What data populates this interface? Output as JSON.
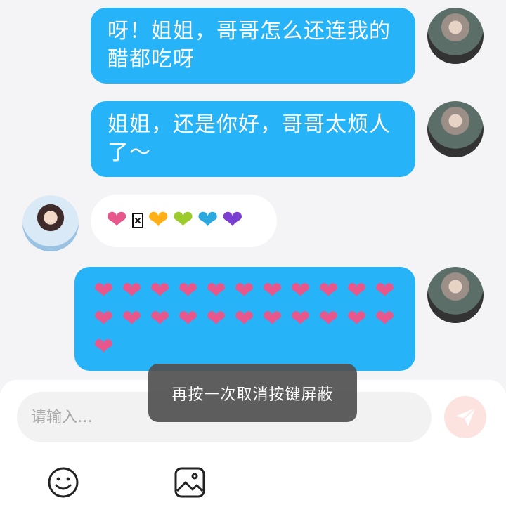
{
  "messages": [
    {
      "side": "me",
      "text": "呀！姐姐，哥哥怎么还连我的醋都吃呀"
    },
    {
      "side": "me",
      "text": "姐姐，还是你好，哥哥太烦人了～"
    },
    {
      "side": "other",
      "hearts": [
        "pink",
        "box",
        "orange",
        "green",
        "blue",
        "purple"
      ]
    },
    {
      "side": "me",
      "pink_heart_count": 23
    }
  ],
  "colors": {
    "my_bubble": "#27b3f7",
    "pink": "#e7578b",
    "orange": "#ffb016",
    "green": "#9bcc2b",
    "blue": "#2aa9df",
    "purple": "#7a3fd0"
  },
  "composer": {
    "placeholder": "请输入…",
    "send_icon": "paper-plane-icon",
    "emoji_icon": "smiley-icon",
    "image_icon": "image-icon"
  },
  "toast": {
    "text": "再按一次取消按键屏蔽"
  }
}
